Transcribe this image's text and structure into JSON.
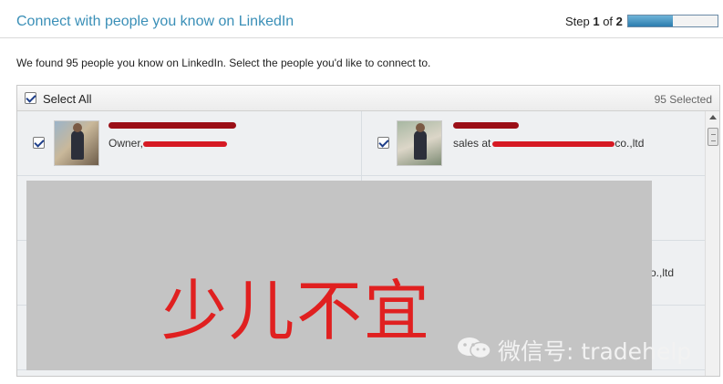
{
  "header": {
    "title": "Connect with people you know on LinkedIn",
    "step_prefix": "Step ",
    "step_current": "1",
    "step_of": " of ",
    "step_total": "2",
    "progress": 0.5
  },
  "intro": "We found 95 people you know on LinkedIn. Select the people you'd like to connect to.",
  "select_all": {
    "label": "Select All",
    "checked": true
  },
  "selected_count": "95 Selected",
  "contacts": [
    {
      "headline": "Owner,",
      "checked": true
    },
    {
      "headline": "sales at",
      "headline_suffix": "co.,ltd",
      "checked": true
    }
  ],
  "partial_row_text": "co.,ltd",
  "overlay": {
    "text": "少儿不宜",
    "background": "#c4c4c4",
    "color": "#e02020"
  },
  "watermark": "微信号: tradehelp",
  "colors": {
    "title": "#3a8fb7",
    "redaction": "#d61a24",
    "name_redaction": "#9b0f17"
  },
  "icons": {
    "checkbox": "check-mark",
    "watermark": "wechat-icon"
  }
}
